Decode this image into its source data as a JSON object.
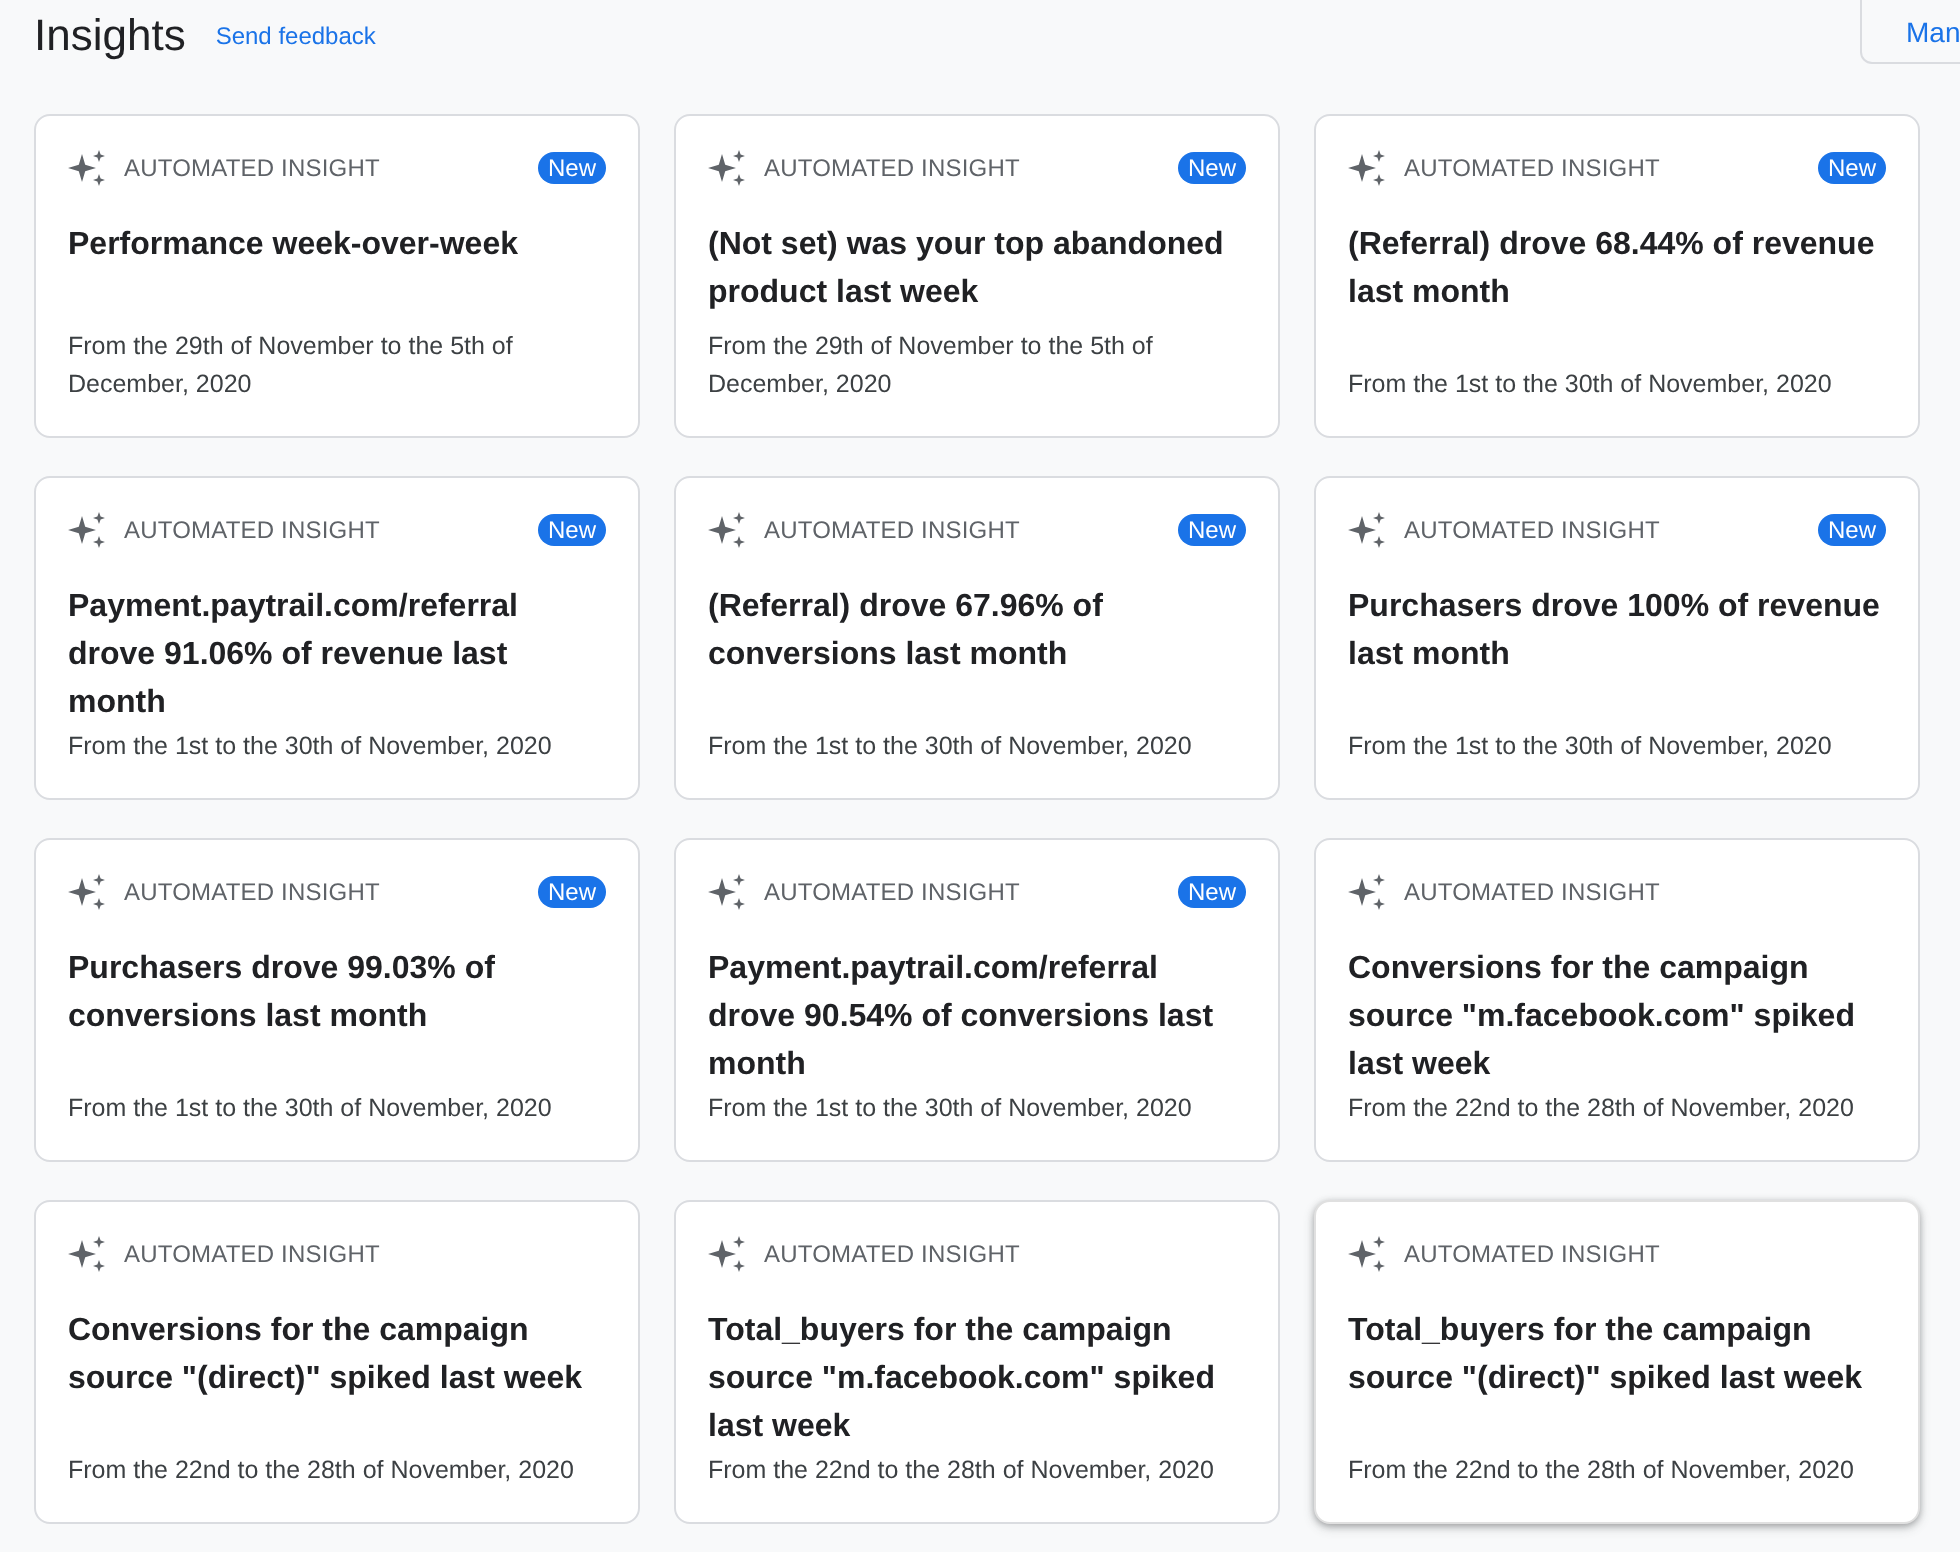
{
  "header": {
    "title": "Insights",
    "feedback_link": "Send feedback",
    "button": "Man"
  },
  "cards": [
    {
      "label": "AUTOMATED INSIGHT",
      "new_badge": "New",
      "title": "Performance week-over-week",
      "date": "From the 29th of November to the 5th of December, 2020",
      "raised": false
    },
    {
      "label": "AUTOMATED INSIGHT",
      "new_badge": "New",
      "title": "(Not set) was your top abandoned product last week",
      "date": "From the 29th of November to the 5th of December, 2020",
      "raised": false
    },
    {
      "label": "AUTOMATED INSIGHT",
      "new_badge": "New",
      "title": "(Referral) drove 68.44% of revenue last month",
      "date": "From the 1st to the 30th of November, 2020",
      "raised": false
    },
    {
      "label": "AUTOMATED INSIGHT",
      "new_badge": "New",
      "title": "Payment.paytrail.com/referral drove 91.06% of revenue last month",
      "date": "From the 1st to the 30th of November, 2020",
      "raised": false
    },
    {
      "label": "AUTOMATED INSIGHT",
      "new_badge": "New",
      "title": "(Referral) drove 67.96% of conversions last month",
      "date": "From the 1st to the 30th of November, 2020",
      "raised": false
    },
    {
      "label": "AUTOMATED INSIGHT",
      "new_badge": "New",
      "title": "Purchasers drove 100% of revenue last month",
      "date": "From the 1st to the 30th of November, 2020",
      "raised": false
    },
    {
      "label": "AUTOMATED INSIGHT",
      "new_badge": "New",
      "title": "Purchasers drove 99.03% of conversions last month",
      "date": "From the 1st to the 30th of November, 2020",
      "raised": false
    },
    {
      "label": "AUTOMATED INSIGHT",
      "new_badge": "New",
      "title": "Payment.paytrail.com/referral drove 90.54% of conversions last month",
      "date": "From the 1st to the 30th of November, 2020",
      "raised": false
    },
    {
      "label": "AUTOMATED INSIGHT",
      "title": "Conversions for the campaign source \"m.facebook.com\" spiked last week",
      "date": "From the 22nd to the 28th of November, 2020",
      "raised": false
    },
    {
      "label": "AUTOMATED INSIGHT",
      "title": "Conversions for the campaign source \"(direct)\" spiked last week",
      "date": "From the 22nd to the 28th of November, 2020",
      "raised": false
    },
    {
      "label": "AUTOMATED INSIGHT",
      "title": "Total_buyers for the campaign source \"m.facebook.com\" spiked last week",
      "date": "From the 22nd to the 28th of November, 2020",
      "raised": false
    },
    {
      "label": "AUTOMATED INSIGHT",
      "title": "Total_buyers for the campaign source \"(direct)\" spiked last week",
      "date": "From the 22nd to the 28th of November, 2020",
      "raised": true
    }
  ]
}
